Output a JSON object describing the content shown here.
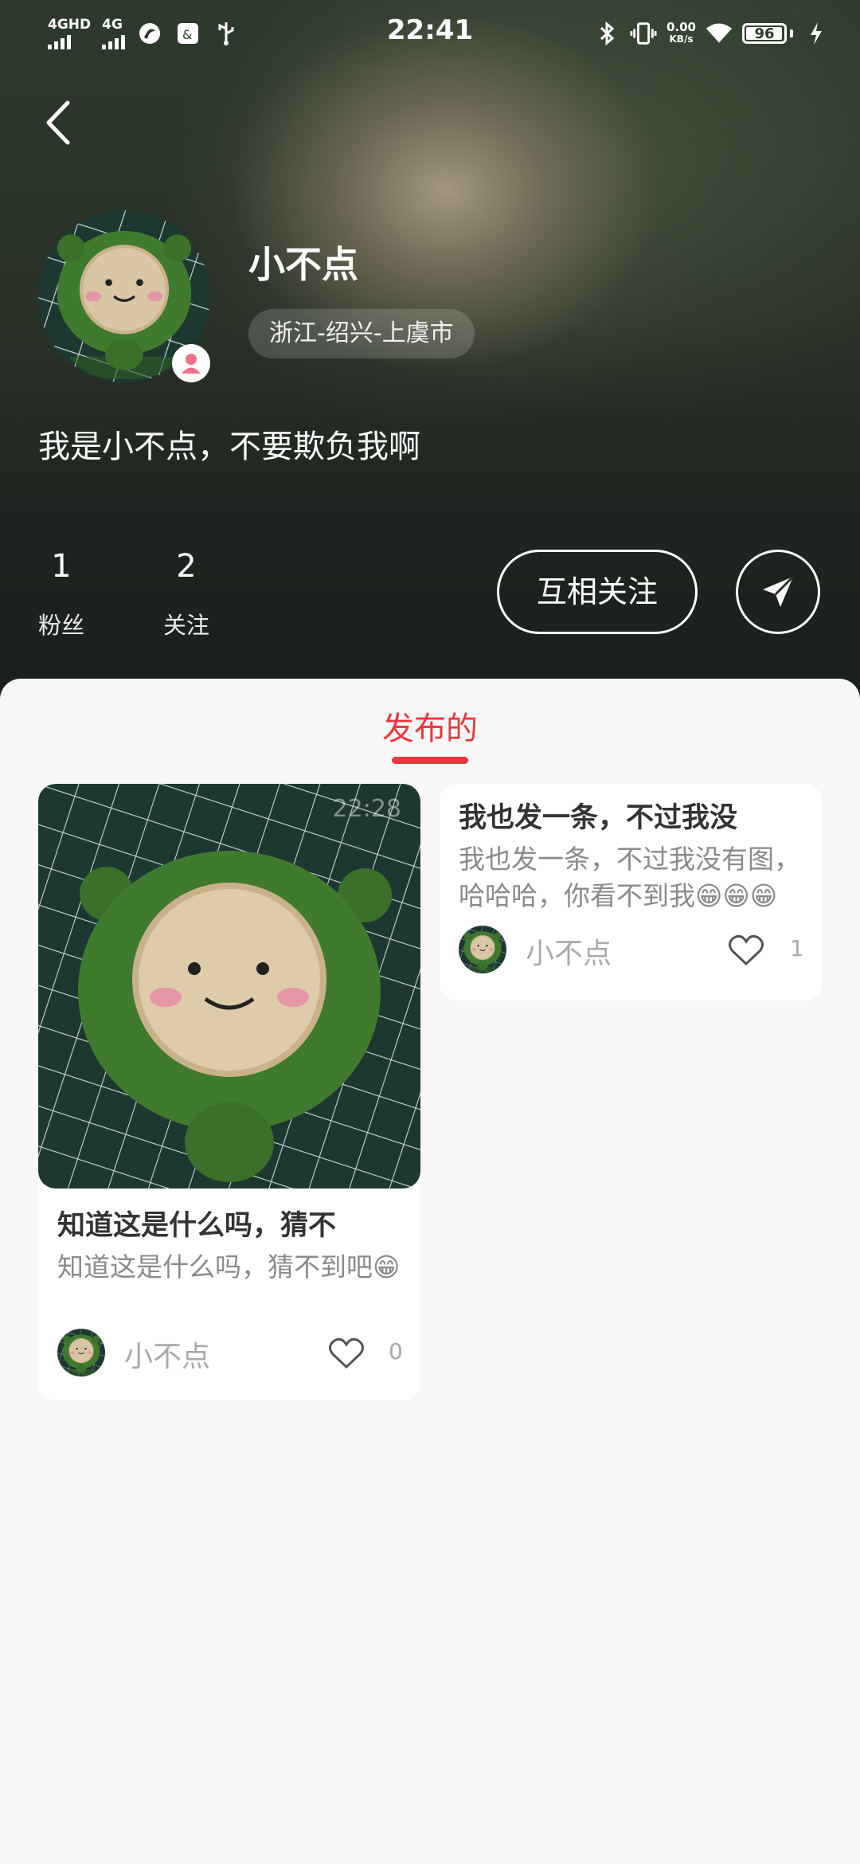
{
  "status_bar": {
    "time": "22:41",
    "signal1_label": "4GHD",
    "signal2_label": "4G",
    "net_speed_value": "0.00",
    "net_speed_unit": "KB/s",
    "battery": "96"
  },
  "profile": {
    "name": "小不点",
    "location": "浙江-绍兴-上虞市",
    "bio": "我是小不点，不要欺负我啊",
    "stats": [
      {
        "value": "1",
        "label": "粉丝"
      },
      {
        "value": "2",
        "label": "关注"
      }
    ],
    "follow_button": "互相关注"
  },
  "tabs": {
    "active": "发布的"
  },
  "posts": [
    {
      "image_time": "22:28",
      "title": "知道这是什么吗，猜不",
      "desc": "知道这是什么吗，猜不到吧😁",
      "author": "小不点",
      "likes": "0"
    },
    {
      "title": "我也发一条，不过我没",
      "desc": "我也发一条，不过我没有图，哈哈哈，你看不到我😁😁😁",
      "author": "小不点",
      "likes": "1"
    }
  ],
  "colors": {
    "accent": "#e8383d",
    "plush_green": "#3f7a2e",
    "mat_dark": "#1f3a33",
    "gender_pink": "#f0708a"
  },
  "icons": [
    "back-icon",
    "send-icon",
    "heart-icon",
    "female-icon",
    "bluetooth-icon",
    "vibrate-icon",
    "wifi-icon",
    "charging-icon",
    "usb-icon"
  ]
}
